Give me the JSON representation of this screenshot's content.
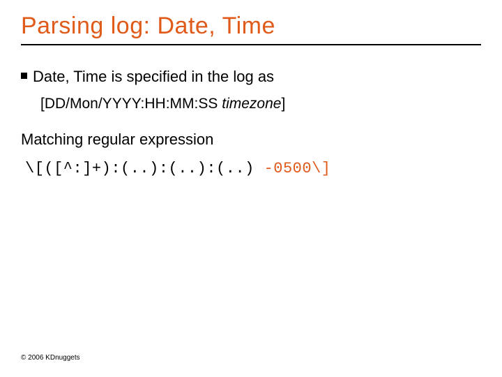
{
  "title": "Parsing log: Date, Time",
  "bullet1": "Date, Time is specified in the log as",
  "format_plain": "[DD/Mon/YYYY:HH:MM:SS ",
  "format_italic": "timezone",
  "format_tail": "]",
  "match_line": "Matching regular expression",
  "regex_black": "\\[([^:]+):(..):(..):(..) ",
  "regex_orange": "-0500\\]",
  "copyright": "© 2006 KDnuggets"
}
